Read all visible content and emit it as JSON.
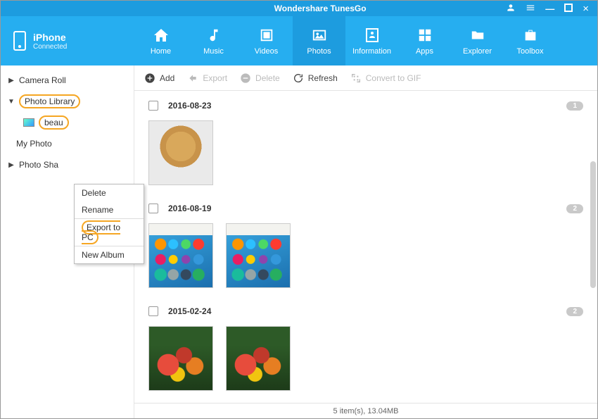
{
  "app": {
    "title": "Wondershare TunesGo"
  },
  "titlebar_icons": {
    "user": "user-icon",
    "menu": "menu-icon",
    "min": "minimize-icon",
    "max": "maximize-icon",
    "close": "close-icon"
  },
  "device": {
    "name": "iPhone",
    "status": "Connected"
  },
  "tabs": [
    {
      "id": "home",
      "label": "Home"
    },
    {
      "id": "music",
      "label": "Music"
    },
    {
      "id": "videos",
      "label": "Videos"
    },
    {
      "id": "photos",
      "label": "Photos",
      "active": true
    },
    {
      "id": "information",
      "label": "Information"
    },
    {
      "id": "apps",
      "label": "Apps"
    },
    {
      "id": "explorer",
      "label": "Explorer"
    },
    {
      "id": "toolbox",
      "label": "Toolbox"
    }
  ],
  "sidebar": {
    "items": [
      {
        "label": "Camera Roll",
        "expand": "collapsed"
      },
      {
        "label": "Photo Library",
        "expand": "expanded",
        "highlight": true
      },
      {
        "label": "My Photo"
      },
      {
        "label": "Photo Sha",
        "expand": "collapsed"
      }
    ],
    "sub_selected": {
      "label": "beau"
    }
  },
  "context_menu": {
    "items": [
      {
        "label": "Delete"
      },
      {
        "label": "Rename"
      },
      {
        "label": "Export to PC",
        "highlight": true,
        "sep": true
      },
      {
        "label": "New Album",
        "sep": true
      }
    ]
  },
  "toolbar": {
    "add": "Add",
    "export": "Export",
    "delete": "Delete",
    "refresh": "Refresh",
    "gif": "Convert to GIF"
  },
  "groups": [
    {
      "date": "2016-08-23",
      "count": "1",
      "thumbs": [
        {
          "kind": "dog"
        }
      ]
    },
    {
      "date": "2016-08-19",
      "count": "2",
      "thumbs": [
        {
          "kind": "ios"
        },
        {
          "kind": "ios"
        }
      ]
    },
    {
      "date": "2015-02-24",
      "count": "2",
      "thumbs": [
        {
          "kind": "flower"
        },
        {
          "kind": "flower"
        }
      ]
    }
  ],
  "status": "5 item(s), 13.04MB"
}
